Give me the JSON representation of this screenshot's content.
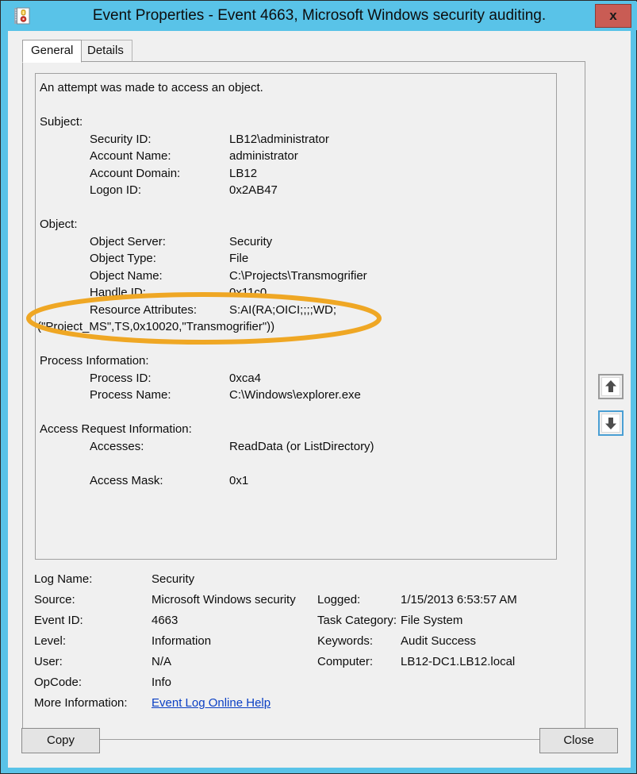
{
  "window": {
    "title": "Event Properties - Event 4663, Microsoft Windows security auditing.",
    "icon": "event-log-icon",
    "close_label": "x",
    "titlebar_color": "#59c3e8",
    "close_button_color": "#c95c54"
  },
  "tabs": [
    {
      "label": "General",
      "active": true
    },
    {
      "label": "Details",
      "active": false
    }
  ],
  "event_description": {
    "headline": "An attempt was made to access an object.",
    "sections": [
      {
        "title": "Subject:",
        "rows": [
          {
            "label": "Security ID:",
            "value": "LB12\\administrator"
          },
          {
            "label": "Account Name:",
            "value": "administrator"
          },
          {
            "label": "Account Domain:",
            "value": "LB12"
          },
          {
            "label": "Logon ID:",
            "value": "0x2AB47"
          }
        ]
      },
      {
        "title": "Object:",
        "rows": [
          {
            "label": "Object Server:",
            "value": "Security"
          },
          {
            "label": "Object Type:",
            "value": "File"
          },
          {
            "label": "Object Name:",
            "value": "C:\\Projects\\Transmogrifier"
          },
          {
            "label": "Handle ID:",
            "value": "0x11c0"
          },
          {
            "label": "Resource Attributes:",
            "value": "S:AI(RA;OICI;;;;WD;"
          }
        ],
        "continuation": "(\"Project_MS\",TS,0x10020,\"Transmogrifier\"))"
      },
      {
        "title": "Process Information:",
        "rows": [
          {
            "label": "Process ID:",
            "value": "0xca4"
          },
          {
            "label": "Process Name:",
            "value": "C:\\Windows\\explorer.exe"
          }
        ]
      },
      {
        "title": "Access Request Information:",
        "rows": [
          {
            "label": "Accesses:",
            "value": "ReadData (or ListDirectory)"
          },
          {
            "label": "Access Mask:",
            "value": "0x1"
          }
        ]
      }
    ]
  },
  "annotation": {
    "shape": "ellipse",
    "color": "#efa724",
    "targets": "Resource Attributes value and its continuation line"
  },
  "metadata": {
    "left": [
      {
        "label": "Log Name:",
        "value": "Security"
      },
      {
        "label": "Source:",
        "value": "Microsoft Windows security"
      },
      {
        "label": "Event ID:",
        "value": "4663"
      },
      {
        "label": "Level:",
        "value": "Information"
      },
      {
        "label": "User:",
        "value": "N/A"
      },
      {
        "label": "OpCode:",
        "value": "Info"
      }
    ],
    "right": [
      {
        "label": "Logged:",
        "value": "1/15/2013 6:53:57 AM"
      },
      {
        "label": "Task Category:",
        "value": "File System"
      },
      {
        "label": "Keywords:",
        "value": "Audit Success"
      },
      {
        "label": "Computer:",
        "value": "LB12-DC1.LB12.local"
      }
    ],
    "more_information_label": "More Information:",
    "more_information_link": "Event Log Online Help"
  },
  "nav_buttons": {
    "up": "previous-event",
    "down": "next-event"
  },
  "actions": {
    "copy_label": "Copy",
    "close_label": "Close"
  }
}
